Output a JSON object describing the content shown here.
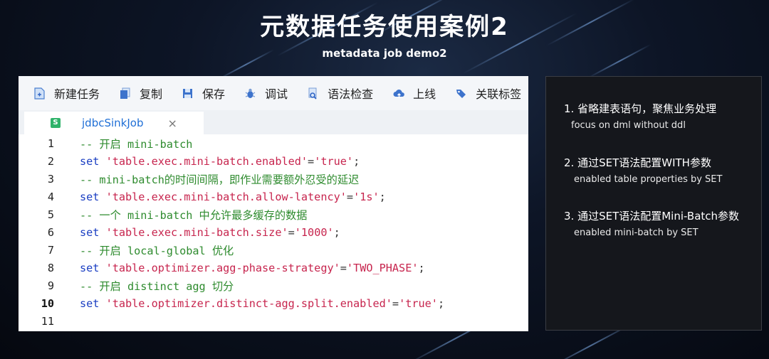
{
  "title": "元数据任务使用案例2",
  "subtitle": "metadata job demo2",
  "toolbar": {
    "items": [
      {
        "label": "新建任务",
        "icon": "new-file-icon"
      },
      {
        "label": "复制",
        "icon": "copy-icon"
      },
      {
        "label": "保存",
        "icon": "save-icon"
      },
      {
        "label": "调试",
        "icon": "debug-icon"
      },
      {
        "label": "语法检查",
        "icon": "syntax-check-icon"
      },
      {
        "label": "上线",
        "icon": "cloud-upload-icon"
      },
      {
        "label": "关联标签",
        "icon": "tag-icon"
      }
    ]
  },
  "tab": {
    "label": "jdbcSinkJob",
    "badge": "S",
    "close": "×"
  },
  "code": {
    "lines": [
      {
        "n": "1",
        "parts": [
          {
            "t": "-- 开启 mini-batch",
            "c": "cm"
          }
        ]
      },
      {
        "n": "2",
        "parts": [
          {
            "t": "set ",
            "c": "kw"
          },
          {
            "t": "'table.exec.mini-batch.enabled'",
            "c": "str"
          },
          {
            "t": "=",
            "c": "op"
          },
          {
            "t": "'true'",
            "c": "str"
          },
          {
            "t": ";",
            "c": "op"
          }
        ]
      },
      {
        "n": "3",
        "parts": [
          {
            "t": "-- mini-batch的时间间隔，即作业需要额外忍受的延迟",
            "c": "cm"
          }
        ]
      },
      {
        "n": "4",
        "parts": [
          {
            "t": "set ",
            "c": "kw"
          },
          {
            "t": "'table.exec.mini-batch.allow-latency'",
            "c": "str"
          },
          {
            "t": "=",
            "c": "op"
          },
          {
            "t": "'1s'",
            "c": "str"
          },
          {
            "t": ";",
            "c": "op"
          }
        ]
      },
      {
        "n": "5",
        "parts": [
          {
            "t": "-- 一个 mini-batch 中允许最多缓存的数据",
            "c": "cm"
          }
        ]
      },
      {
        "n": "6",
        "parts": [
          {
            "t": "set ",
            "c": "kw"
          },
          {
            "t": "'table.exec.mini-batch.size'",
            "c": "str"
          },
          {
            "t": "=",
            "c": "op"
          },
          {
            "t": "'1000'",
            "c": "str"
          },
          {
            "t": ";",
            "c": "op"
          }
        ]
      },
      {
        "n": "7",
        "parts": [
          {
            "t": "-- 开启 local-global 优化",
            "c": "cm"
          }
        ]
      },
      {
        "n": "8",
        "parts": [
          {
            "t": "set ",
            "c": "kw"
          },
          {
            "t": "'table.optimizer.agg-phase-strategy'",
            "c": "str"
          },
          {
            "t": "=",
            "c": "op"
          },
          {
            "t": "'TWO_PHASE'",
            "c": "str"
          },
          {
            "t": ";",
            "c": "op"
          }
        ]
      },
      {
        "n": "9",
        "parts": [
          {
            "t": "-- 开启 distinct agg 切分",
            "c": "cm"
          }
        ]
      },
      {
        "n": "10",
        "active": true,
        "parts": [
          {
            "t": "set ",
            "c": "kw"
          },
          {
            "t": "'table.optimizer.distinct-agg.split.enabled'",
            "c": "str"
          },
          {
            "t": "=",
            "c": "op"
          },
          {
            "t": "'true'",
            "c": "str"
          },
          {
            "t": ";",
            "c": "op"
          }
        ]
      },
      {
        "n": "11",
        "parts": []
      }
    ]
  },
  "info": {
    "items": [
      {
        "heading": "1. 省略建表语句，聚焦业务处理",
        "sub": "focus on dml without ddl"
      },
      {
        "heading": "2. 通过SET语法配置WITH参数",
        "sub": "enabled table properties by SET"
      },
      {
        "heading": "3. 通过SET语法配置Mini-Batch参数",
        "sub": "enabled mini-batch by SET"
      }
    ]
  },
  "colors": {
    "comment": "#2e8b2e",
    "keyword": "#1a3ec2",
    "string": "#c7254e",
    "tab_label": "#1f6fd6"
  }
}
